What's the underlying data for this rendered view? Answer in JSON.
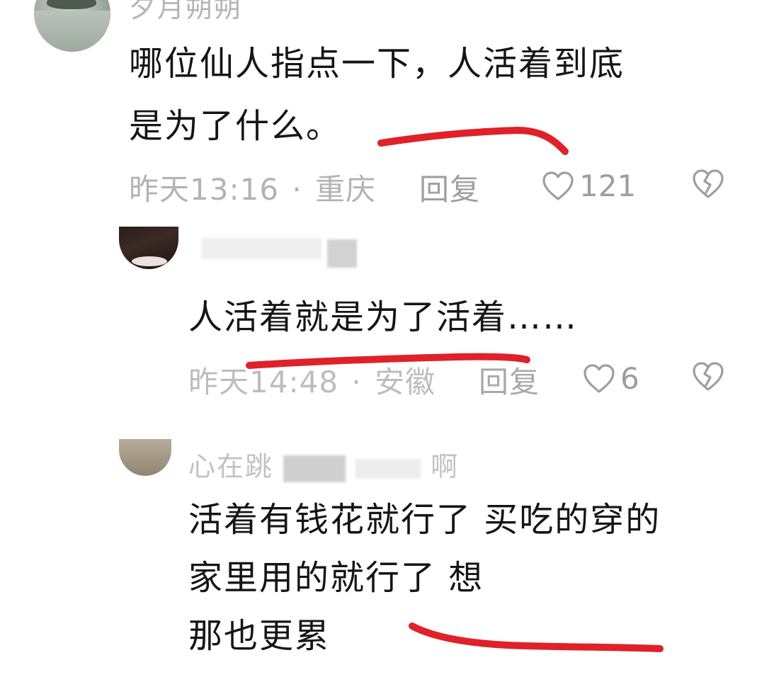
{
  "comments": [
    {
      "username": "夕月朔朔",
      "text_lines": [
        "哪位仙人指点一下，人活着到底",
        "是为了什么。"
      ],
      "time": "昨天13:16",
      "location": "重庆",
      "separator": "·",
      "reply_label": "回复",
      "likes": "121",
      "icons": [
        "heart-icon",
        "dislike-icon"
      ]
    },
    {
      "username": "",
      "text_lines": [
        "人活着就是为了活着……"
      ],
      "time": "昨天14:48",
      "location": "安徽",
      "separator": "·",
      "reply_label": "回复",
      "likes": "6",
      "icons": [
        "heart-icon",
        "dislike-icon"
      ]
    },
    {
      "username_parts": [
        "心在跳",
        "啊"
      ],
      "text_lines": [
        "活着有钱花就行了 买吃的穿的",
        "家里用的就行了 想",
        "那也更累"
      ]
    }
  ],
  "colors": {
    "highlight": "#e0212a",
    "meta_text": "#b3b3b3",
    "body_text": "#151515"
  }
}
